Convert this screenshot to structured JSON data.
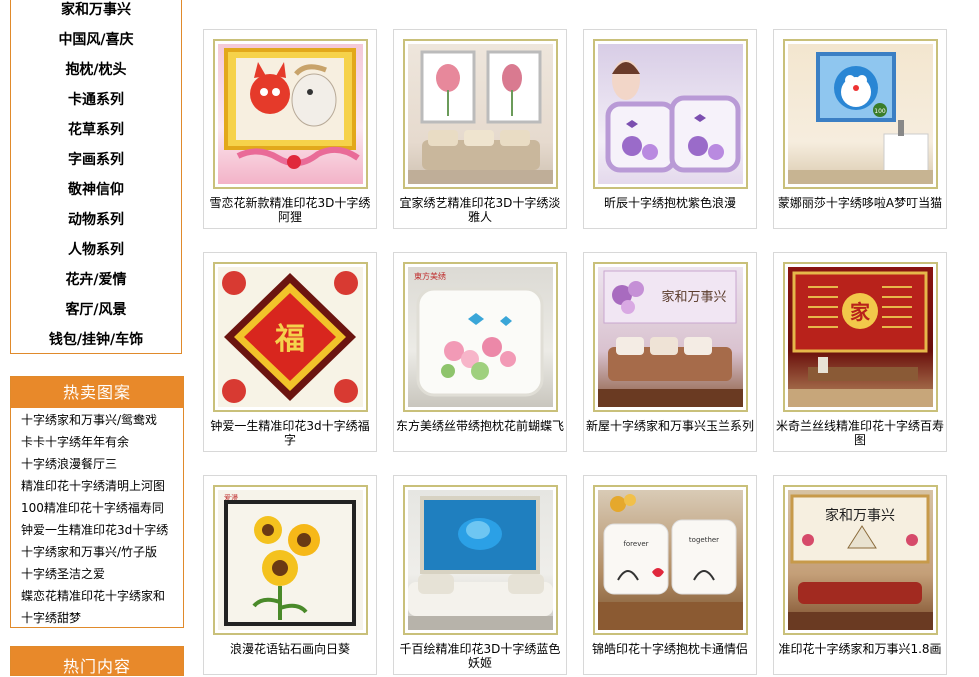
{
  "sidebar": {
    "categories": [
      "家和万事兴",
      "中国风/喜庆",
      "抱枕/枕头",
      "卡通系列",
      "花草系列",
      "字画系列",
      "敬神信仰",
      "动物系列",
      "人物系列",
      "花卉/爱情",
      "客厅/风景",
      "钱包/挂钟/车饰"
    ],
    "hot_title": "热卖图案",
    "hot_items": [
      "十字绣家和万事兴/鸳鸯戏",
      "卡卡十字绣年年有余",
      "十字绣浪漫餐厅三",
      "精准印花十字绣清明上河图",
      "100精准印花十字绣福寿同",
      "钟爱一生精准印花3d十字绣",
      "十字绣家和万事兴/竹子版",
      "十字绣圣洁之爱",
      "蝶恋花精准印花十字绣家和",
      "十字绣甜梦"
    ],
    "hot2_title": "热门内容"
  },
  "products": [
    {
      "caption": "雪恋花新款精准印花3D十字绣阿狸"
    },
    {
      "caption": "宜家绣艺精准印花3D十字绣淡雅人"
    },
    {
      "caption": "昕辰十字绣抱枕紫色浪漫"
    },
    {
      "caption": "蒙娜丽莎十字绣哆啦A梦叮当猫"
    },
    {
      "caption": "钟爱一生精准印花3d十字绣福字"
    },
    {
      "caption": "东方美绣丝带绣抱枕花前蝴蝶飞"
    },
    {
      "caption": "新屋十字绣家和万事兴玉兰系列"
    },
    {
      "caption": "米奇兰丝线精准印花十字绣百寿图"
    },
    {
      "caption": "浪漫花语钻石画向日葵"
    },
    {
      "caption": "千百绘精准印花3D十字绣蓝色妖姬"
    },
    {
      "caption": "锦皓印花十字绣抱枕卡通情侣"
    },
    {
      "caption": "准印花十字绣家和万事兴1.8画"
    }
  ],
  "picture_text": {
    "fu": "福",
    "jia": "家",
    "jiahe": "家和万事兴",
    "brand1": "東方美绣",
    "brand2": "爱漫",
    "pillow_text_a": "forever",
    "pillow_text_b": "together",
    "badge": "100"
  },
  "colors": {
    "accent": "#e8892a",
    "frame": "#c9c07a",
    "card_border": "#d8d8d8"
  }
}
